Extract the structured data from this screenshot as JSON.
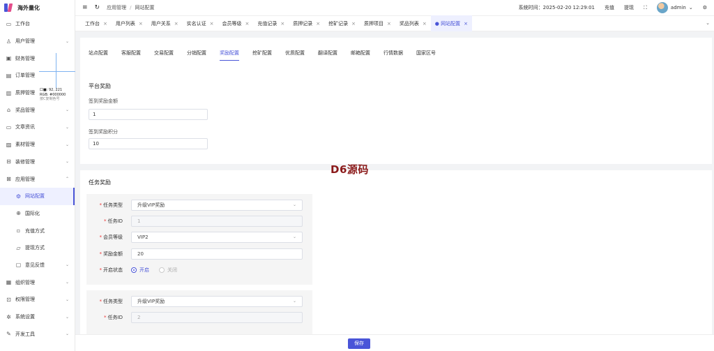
{
  "app": {
    "name": "海外量化"
  },
  "sidebar": {
    "items": [
      {
        "label": "工作台",
        "icon": "monitor-icon",
        "glyph": "▭",
        "chev": ""
      },
      {
        "label": "用户管理",
        "icon": "user-icon",
        "glyph": "♙",
        "chev": "⌄"
      },
      {
        "label": "财务管理",
        "icon": "finance-icon",
        "glyph": "▣",
        "chev": ""
      },
      {
        "label": "订单管理",
        "icon": "order-icon",
        "glyph": "▤",
        "chev": ""
      },
      {
        "label": "质押管理",
        "icon": "pledge-icon",
        "glyph": "▥",
        "chev": ""
      },
      {
        "label": "奖品管理",
        "icon": "gift-icon",
        "glyph": "⌂",
        "chev": "⌄"
      },
      {
        "label": "文章资讯",
        "icon": "article-icon",
        "glyph": "▭",
        "chev": "⌄"
      },
      {
        "label": "素材管理",
        "icon": "material-icon",
        "glyph": "▨",
        "chev": "⌄"
      },
      {
        "label": "装修管理",
        "icon": "decorate-icon",
        "glyph": "⊟",
        "chev": "⌄"
      },
      {
        "label": "应用管理",
        "icon": "app-icon",
        "glyph": "⊠",
        "chev": "⌃"
      },
      {
        "label": "网站配置",
        "icon": "settings-icon",
        "glyph": "⚙",
        "chev": "",
        "sub": true,
        "active": true
      },
      {
        "label": "国际化",
        "icon": "globe-icon",
        "glyph": "⊕",
        "chev": "",
        "sub": true
      },
      {
        "label": "充值方式",
        "icon": "recharge-icon",
        "glyph": "▫",
        "chev": "",
        "sub": true
      },
      {
        "label": "提现方式",
        "icon": "withdraw-icon",
        "glyph": "▱",
        "chev": "",
        "sub": true
      },
      {
        "label": "意见反馈",
        "icon": "feedback-icon",
        "glyph": "▢",
        "chev": "⌄",
        "sub": true
      },
      {
        "label": "组织管理",
        "icon": "org-icon",
        "glyph": "▦",
        "chev": "⌄"
      },
      {
        "label": "权限管理",
        "icon": "permission-icon",
        "glyph": "⊡",
        "chev": "⌄"
      },
      {
        "label": "系统设置",
        "icon": "gear-icon",
        "glyph": "✲",
        "chev": "⌄"
      },
      {
        "label": "开发工具",
        "icon": "tool-icon",
        "glyph": "✎",
        "chev": "⌄"
      }
    ]
  },
  "picker": {
    "line1": "口■: 92, 221",
    "line2": "RGB: #000000",
    "line3": "按C复制色号"
  },
  "header": {
    "menu_icon": "≡",
    "refresh_icon": "↻",
    "breadcrumb": [
      "应用管理",
      "网站配置"
    ],
    "breadcrumb_sep": "/",
    "system_time": "系统时间：2025-02-20 12:29:01",
    "recharge": "充值",
    "withdraw": "提现",
    "fullscreen_icon": "⛶",
    "username": "admin",
    "user_chev": "⌄",
    "settings_glyph": "⚙"
  },
  "tabs": [
    {
      "label": "工作台"
    },
    {
      "label": "用户列表"
    },
    {
      "label": "用户关系"
    },
    {
      "label": "实名认证"
    },
    {
      "label": "会员等级"
    },
    {
      "label": "充值记录"
    },
    {
      "label": "质押记录"
    },
    {
      "label": "挖矿记录"
    },
    {
      "label": "质押项目"
    },
    {
      "label": "奖品列表"
    },
    {
      "label": "● 网站配置",
      "active": true
    }
  ],
  "tab_close": "×",
  "tabs_more": "⌄",
  "config_tabs": [
    {
      "label": "站点配置"
    },
    {
      "label": "客服配置"
    },
    {
      "label": "交易配置"
    },
    {
      "label": "分销配置"
    },
    {
      "label": "奖励配置",
      "active": true
    },
    {
      "label": "挖矿配置"
    },
    {
      "label": "优质配置"
    },
    {
      "label": "翻译配置"
    },
    {
      "label": "邮箱配置"
    },
    {
      "label": "行情数据"
    },
    {
      "label": "国家区号"
    }
  ],
  "platform": {
    "title": "平台奖励",
    "sign_amount_label": "签到奖励金额",
    "sign_amount": "1",
    "sign_points_label": "签到奖励积分",
    "sign_points": "10"
  },
  "task": {
    "title": "任务奖励",
    "required_mark": "*",
    "labels": {
      "type": "任务类型",
      "id": "任务ID",
      "level": "会员等级",
      "amount": "奖励金额",
      "status": "开启状态"
    },
    "caret": "⌄",
    "items": [
      {
        "type": "升级VIP奖励",
        "id": "1",
        "level": "VIP2",
        "amount": "20",
        "status_on": "开启",
        "status_off": "关闭"
      },
      {
        "type": "升级VIP奖励",
        "id": "2"
      }
    ]
  },
  "watermark": "D6源码",
  "footer": {
    "save": "保存"
  },
  "colors": {
    "accent": "#4a55d8",
    "watermark": "#8b1a1a"
  }
}
